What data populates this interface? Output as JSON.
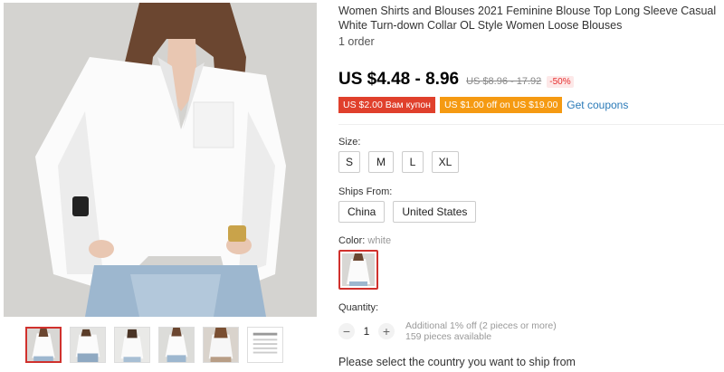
{
  "product": {
    "title": "Women Shirts and Blouses 2021 Feminine Blouse Top Long Sleeve Casual White Turn-down Collar OL Style Women Loose Blouses",
    "orders": "1 order",
    "price": "US $4.48 - 8.96",
    "old_price": "US $8.96 - 17.92",
    "discount": "-50%"
  },
  "coupons": {
    "items": [
      "US $2.00 Вам купон",
      "US $1.00 off on US $19.00"
    ],
    "get_label": "Get coupons"
  },
  "size": {
    "label": "Size:",
    "options": [
      "S",
      "M",
      "L",
      "XL"
    ]
  },
  "ships_from": {
    "label": "Ships From:",
    "options": [
      "China",
      "United States"
    ]
  },
  "color": {
    "label": "Color:",
    "selected": "white"
  },
  "quantity": {
    "label": "Quantity:",
    "minus": "−",
    "value": "1",
    "plus": "+",
    "note_line1": "Additional 1% off (2 pieces or more)",
    "note_line2": "159 pieces available"
  },
  "shipping_message": "Please select the country you want to ship from",
  "gallery": {
    "thumb_count": 6,
    "active_thumb": 0
  },
  "colors": {
    "price": "#000000",
    "accent_red": "#d0312d",
    "coupon_red": "#e0402c",
    "coupon_orange": "#f59a12",
    "link": "#2a7ab8"
  }
}
